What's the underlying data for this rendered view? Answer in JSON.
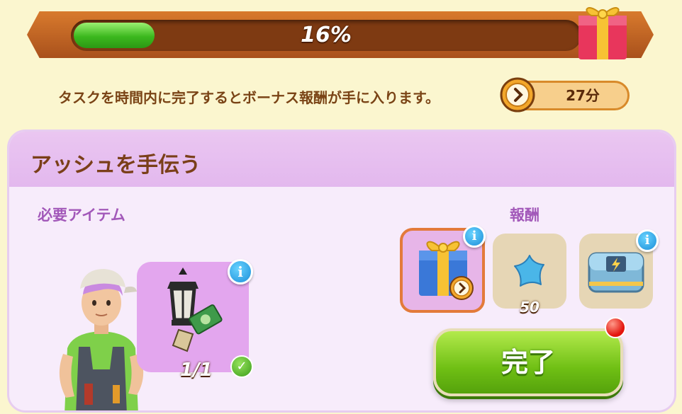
{
  "progress": {
    "percent": 16,
    "label": "16%"
  },
  "bonus": {
    "message": "タスクを時間内に完了するとボーナス報酬が手に入ります。",
    "time_remaining": "27分"
  },
  "panel": {
    "title": "アッシュを手伝う",
    "required_label": "必要アイテム",
    "reward_label": "報酬",
    "required_item": {
      "icon": "street-lamp-icon",
      "count": "1/1",
      "status": "complete"
    },
    "rewards": [
      {
        "icon": "gift-box-icon",
        "timed": true
      },
      {
        "icon": "blue-star-icon",
        "quantity": "50"
      },
      {
        "icon": "blue-chest-icon"
      }
    ],
    "complete_button": "完了"
  },
  "colors": {
    "accent_green": "#6fbf14",
    "panel_bg": "#f7ecfb",
    "title_brown": "#7a3f19",
    "label_purple": "#a258b9"
  }
}
